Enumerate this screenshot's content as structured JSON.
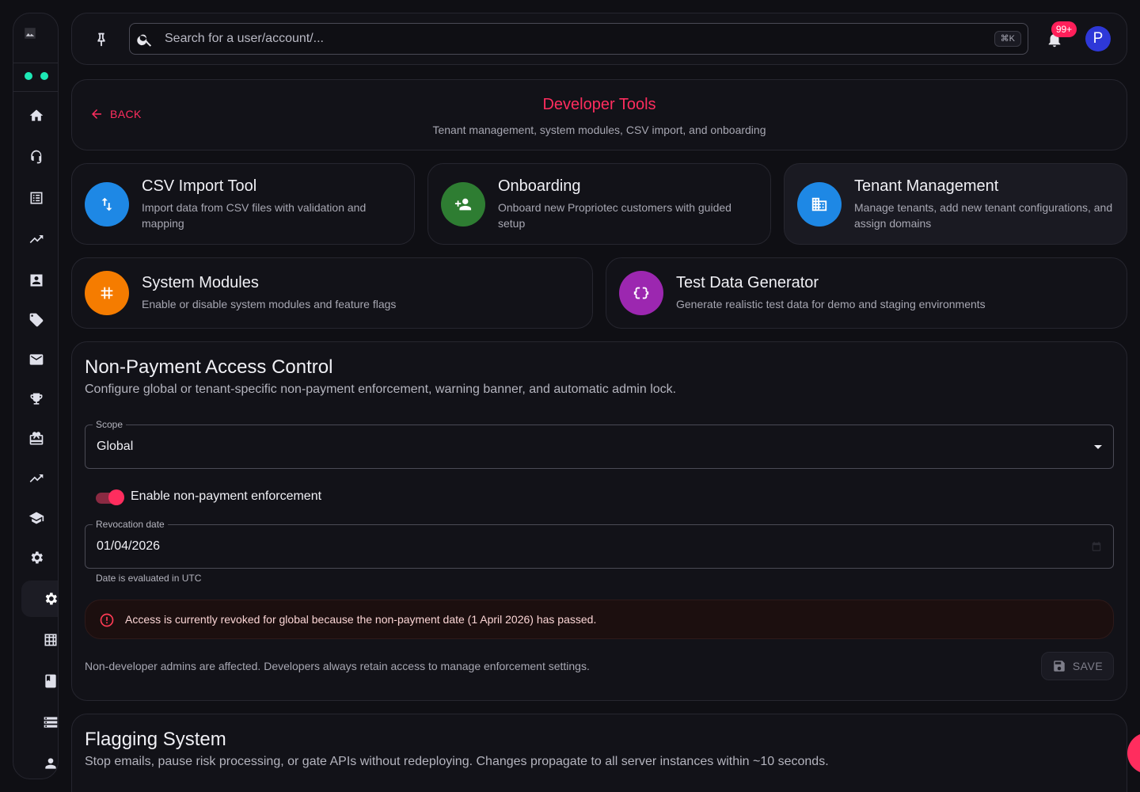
{
  "sidebar": {
    "items": [
      {
        "icon": "home-icon"
      },
      {
        "icon": "support-agent-icon"
      },
      {
        "icon": "list-alt-icon"
      },
      {
        "icon": "trending-up-icon"
      },
      {
        "icon": "contact-card-icon"
      },
      {
        "icon": "tag-icon"
      },
      {
        "icon": "mail-icon"
      },
      {
        "icon": "trophy-icon"
      },
      {
        "icon": "redeem-icon"
      },
      {
        "icon": "trending-up-icon"
      },
      {
        "icon": "school-icon"
      },
      {
        "icon": "gear-icon"
      },
      {
        "icon": "gear-icon",
        "active": true
      },
      {
        "icon": "grid-icon"
      },
      {
        "icon": "book-icon"
      },
      {
        "icon": "storage-icon"
      },
      {
        "icon": "person-icon"
      }
    ],
    "status_color": "#1de9b6"
  },
  "topbar": {
    "search_placeholder": "Search for a user/account/...",
    "shortcut": "⌘K",
    "notification_count": "99+",
    "avatar_initial": "P",
    "avatar_color": "#2e38d8"
  },
  "header": {
    "back_label": "BACK",
    "title": "Developer Tools",
    "subtitle": "Tenant management, system modules, CSV import, and onboarding"
  },
  "tools": [
    {
      "title": "CSV Import Tool",
      "description": "Import data from CSV files with validation and mapping",
      "icon": "swap-vert-icon",
      "color": "#1e88e5"
    },
    {
      "title": "Onboarding",
      "description": "Onboard new Propriotec customers with guided setup",
      "icon": "person-add-icon",
      "color": "#2e7d32"
    },
    {
      "title": "Tenant Management",
      "description": "Manage tenants, add new tenant configurations, and assign domains",
      "icon": "business-icon",
      "color": "#1e88e5"
    },
    {
      "title": "System Modules",
      "description": "Enable or disable system modules and feature flags",
      "icon": "hash-icon",
      "color": "#f57c00"
    },
    {
      "title": "Test Data Generator",
      "description": "Generate realistic test data for demo and staging environments",
      "icon": "data-object-icon",
      "color": "#9c27b0"
    }
  ],
  "access_control": {
    "title": "Non-Payment Access Control",
    "subtitle": "Configure global or tenant-specific non-payment enforcement, warning banner, and automatic admin lock.",
    "scope_label": "Scope",
    "scope_value": "Global",
    "toggle_label": "Enable non-payment enforcement",
    "toggle_on": true,
    "date_label": "Revocation date",
    "date_value": "01/04/2026",
    "date_helper": "Date is evaluated in UTC",
    "alert_text": "Access is currently revoked for global because the non-payment date (1 April 2026) has passed.",
    "footer_note": "Non-developer admins are affected. Developers always retain access to manage enforcement settings.",
    "save_label": "SAVE"
  },
  "flagging": {
    "title": "Flagging System",
    "subtitle": "Stop emails, pause risk processing, or gate APIs without redeploying. Changes propagate to all server instances within ~10 seconds."
  },
  "colors": {
    "accent": "#ff2d5e",
    "background": "#0f0f14",
    "surface": "#121218"
  }
}
